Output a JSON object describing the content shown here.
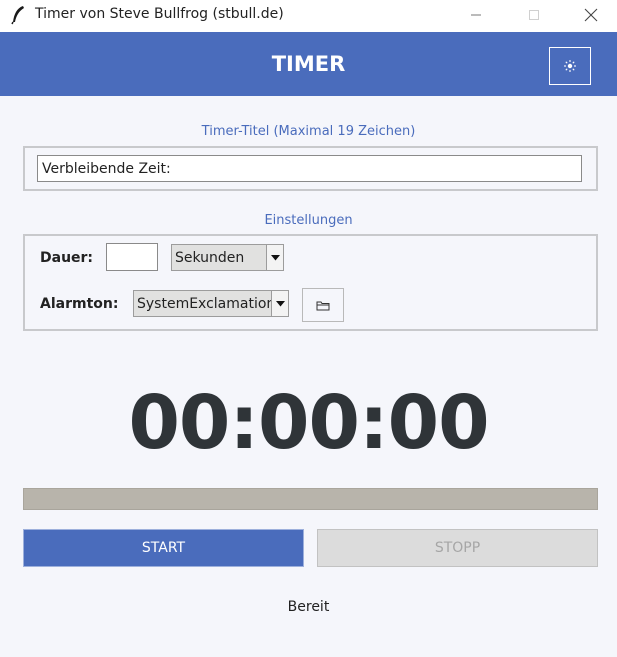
{
  "window": {
    "title": "Timer von Steve Bullfrog (stbull.de)"
  },
  "header": {
    "title": "TIMER",
    "theme_button_icon": "sun-icon",
    "accent_color": "#4a6cbc"
  },
  "title_section": {
    "label": "Timer-Titel (Maximal 19 Zeichen)",
    "input_value": "Verbleibende Zeit:"
  },
  "settings": {
    "label": "Einstellungen",
    "duration_label": "Dauer:",
    "duration_value": "",
    "unit_selected": "Sekunden",
    "alarm_label": "Alarmton:",
    "alarm_selected": "SystemExclamation",
    "browse_icon": "folder-icon"
  },
  "clock": {
    "display": "00:00:00"
  },
  "progress": {
    "fraction": 0
  },
  "buttons": {
    "start_label": "START",
    "stop_label": "STOPP"
  },
  "status": {
    "text": "Bereit"
  }
}
